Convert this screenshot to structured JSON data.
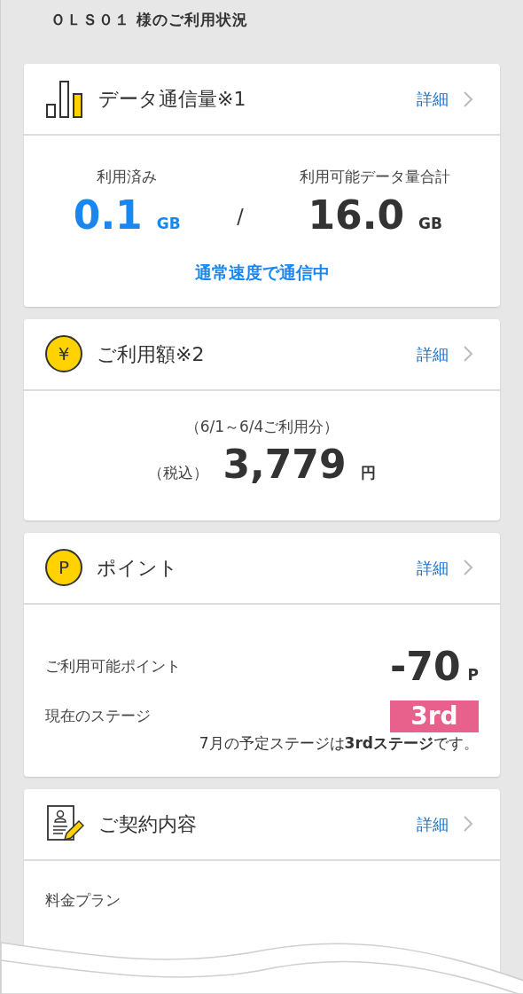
{
  "page_title": "ＯＬＳ０１ 様のご利用状況",
  "cards": [
    {
      "kind": "data",
      "title": "データ通信量※1",
      "link": "詳細",
      "used_label": "利用済み",
      "used_value": "0.1",
      "used_unit": "GB",
      "separator": "/",
      "total_label": "利用可能データ量合計",
      "total_value": "16.0",
      "total_unit": "GB",
      "status": "通常速度で通信中"
    },
    {
      "kind": "fee",
      "icon_text": "¥",
      "title": "ご利用額※2",
      "link": "詳細",
      "period": "（6/1～6/4ご利用分）",
      "tax_label": "（税込）",
      "amount": "3,779",
      "unit": "円"
    },
    {
      "kind": "point",
      "icon_text": "P",
      "title": "ポイント",
      "link": "詳細",
      "points_label": "ご利用可能ポイント",
      "points_value": "-70",
      "points_unit": "P",
      "stage_label": "現在のステージ",
      "stage": "3rd",
      "note": "7月の予定ステージは**3rdステージ**です。"
    },
    {
      "kind": "contract",
      "title": "ご契約内容",
      "link": "詳細",
      "plan_label": "料金プラン"
    }
  ]
}
